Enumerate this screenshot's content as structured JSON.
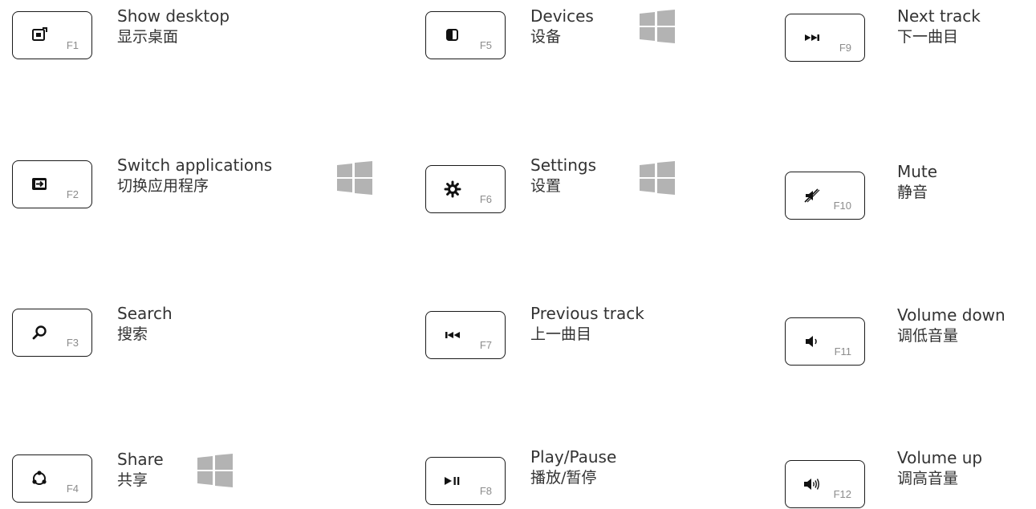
{
  "keys": [
    {
      "fkey": "F1",
      "en": "Show desktop",
      "zh": "显示桌面",
      "icon": "show-desktop-icon",
      "windows_only": false
    },
    {
      "fkey": "F2",
      "en": "Switch applications",
      "zh": "切换应用程序",
      "icon": "switch-apps-icon",
      "windows_only": true
    },
    {
      "fkey": "F3",
      "en": "Search",
      "zh": "搜索",
      "icon": "search-icon",
      "windows_only": false
    },
    {
      "fkey": "F4",
      "en": "Share",
      "zh": "共享",
      "icon": "share-icon",
      "windows_only": true
    },
    {
      "fkey": "F5",
      "en": "Devices",
      "zh": "设备",
      "icon": "devices-icon",
      "windows_only": true
    },
    {
      "fkey": "F6",
      "en": "Settings",
      "zh": "设置",
      "icon": "settings-gear-icon",
      "windows_only": true
    },
    {
      "fkey": "F7",
      "en": "Previous track",
      "zh": "上一曲目",
      "icon": "previous-track-icon",
      "windows_only": false
    },
    {
      "fkey": "F8",
      "en": "Play/Pause",
      "zh": "播放/暂停",
      "icon": "play-pause-icon",
      "windows_only": false
    },
    {
      "fkey": "F9",
      "en": "Next track",
      "zh": "下一曲目",
      "icon": "next-track-icon",
      "windows_only": false
    },
    {
      "fkey": "F10",
      "en": "Mute",
      "zh": "静音",
      "icon": "mute-icon",
      "windows_only": false
    },
    {
      "fkey": "F11",
      "en": "Volume down",
      "zh": "调低音量",
      "icon": "volume-down-icon",
      "windows_only": false
    },
    {
      "fkey": "F12",
      "en": "Volume up",
      "zh": "调高音量",
      "icon": "volume-up-icon",
      "windows_only": false
    }
  ],
  "windows_logo_icon": "windows-logo-icon",
  "colors": {
    "key_border": "#1a1a1a",
    "fkey_text": "#8c8c8c",
    "label_text": "#333333",
    "windows_logo": "#b3b3b3"
  }
}
